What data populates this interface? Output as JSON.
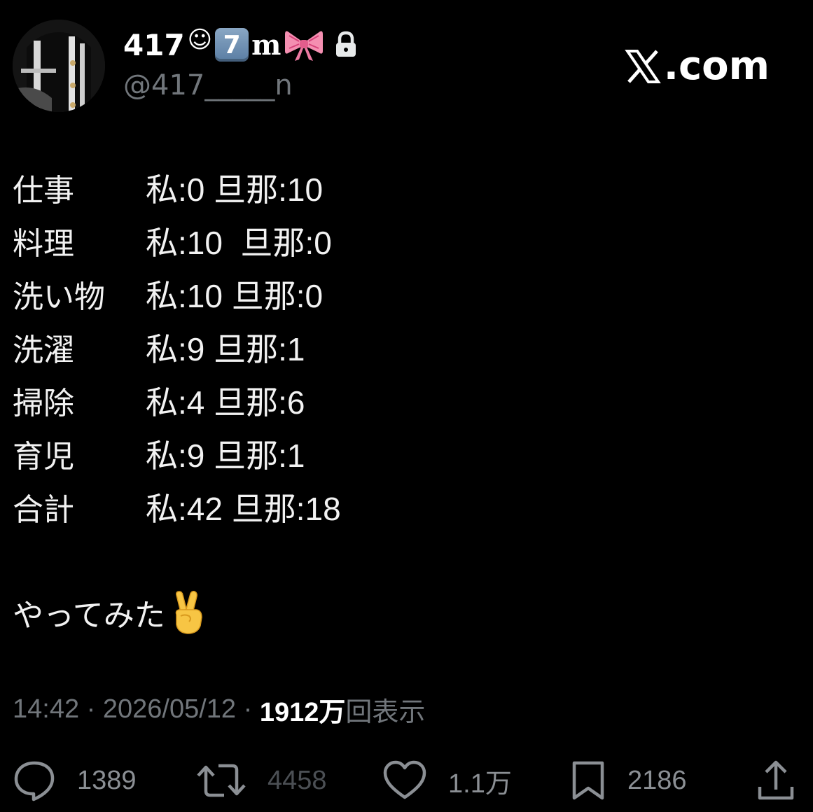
{
  "header": {
    "display_name": "417",
    "display_name_emoji": [
      "☺",
      "7",
      "m",
      "🎀"
    ],
    "protected": true,
    "handle": "@417_____n",
    "brand": "X.com"
  },
  "tweet": {
    "rows": [
      {
        "label": "仕事",
        "value": "私:0 旦那:10"
      },
      {
        "label": "料理",
        "value": "私:10  旦那:0"
      },
      {
        "label": "洗い物",
        "value": "私:10 旦那:0"
      },
      {
        "label": "洗濯",
        "value": "私:9 旦那:1"
      },
      {
        "label": "掃除",
        "value": "私:4 旦那:6"
      },
      {
        "label": "育児",
        "value": "私:9 旦那:1"
      },
      {
        "label": "合計",
        "value": "私:42 旦那:18"
      }
    ],
    "closing_text": "やってみた"
  },
  "meta": {
    "time": "14:42",
    "separator": " · ",
    "date": "2026/05/12",
    "views_count": "1912万",
    "views_label": "回表示"
  },
  "actions": {
    "replies": "1389",
    "reposts": "4458",
    "likes": "1.1万",
    "bookmarks": "2186"
  },
  "colors": {
    "background": "#000000",
    "text": "#e7e9ea",
    "secondary": "#71767b"
  }
}
